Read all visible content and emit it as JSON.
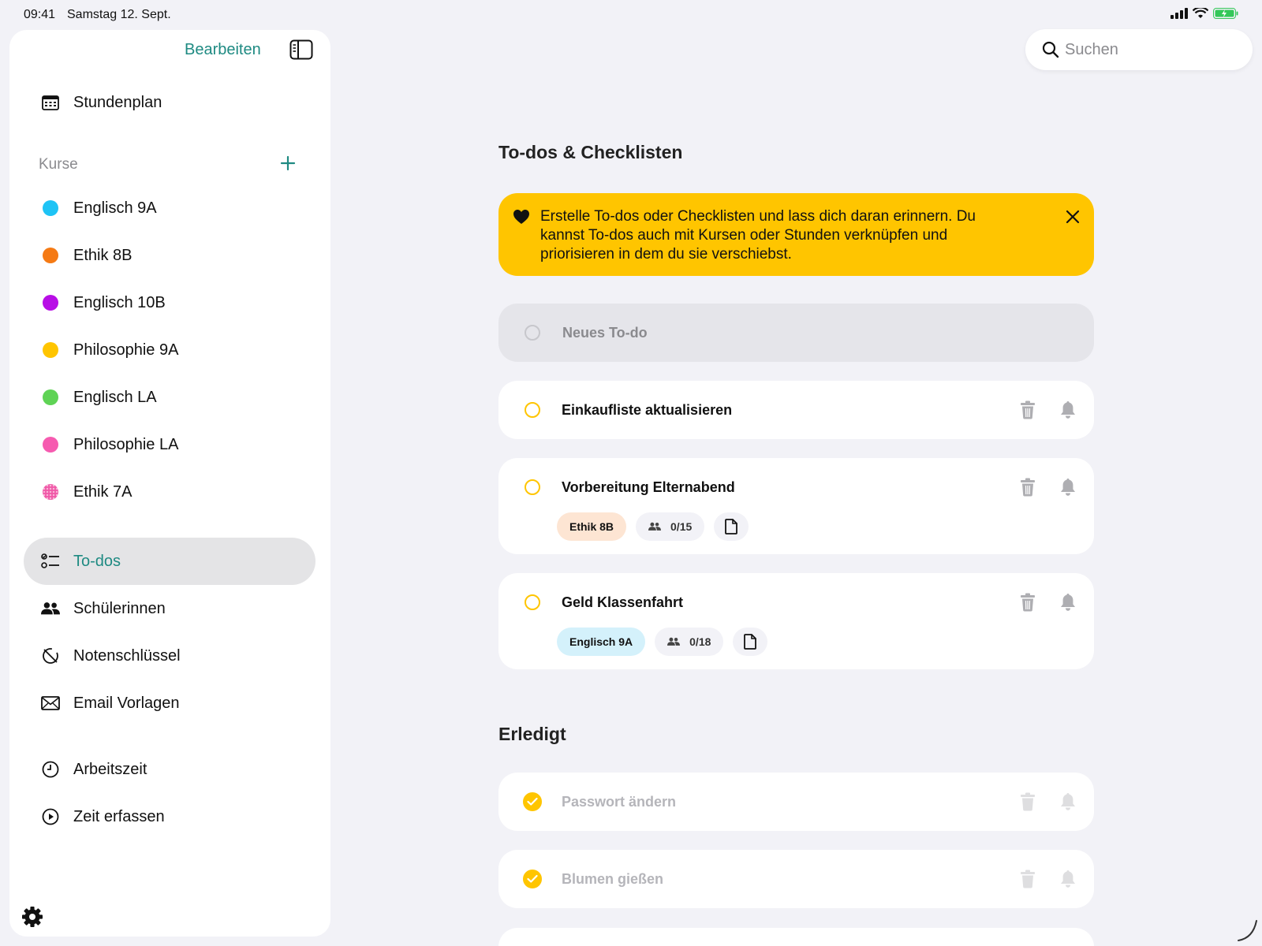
{
  "status_bar": {
    "time": "09:41",
    "date": "Samstag 12. Sept."
  },
  "sidebar": {
    "edit_label": "Bearbeiten",
    "schedule_label": "Stundenplan",
    "courses_section_label": "Kurse",
    "courses": [
      {
        "label": "Englisch 9A",
        "color": "#1ec3f5"
      },
      {
        "label": "Ethik 8B",
        "color": "#f57a14"
      },
      {
        "label": "Englisch 10B",
        "color": "#b80ee6"
      },
      {
        "label": "Philosophie 9A",
        "color": "#ffc500"
      },
      {
        "label": "Englisch LA",
        "color": "#5fd355"
      },
      {
        "label": "Philosophie LA",
        "color": "#f65bb0"
      },
      {
        "label": "Ethik 7A",
        "color": "#f05aa8"
      }
    ],
    "items": [
      {
        "label": "To-dos",
        "active": true
      },
      {
        "label": "Schülerinnen"
      },
      {
        "label": "Notenschlüssel"
      },
      {
        "label": "Email Vorlagen"
      },
      {
        "label": "Arbeitszeit"
      },
      {
        "label": "Zeit erfassen"
      }
    ]
  },
  "search": {
    "placeholder": "Suchen"
  },
  "main": {
    "title": "To-dos & Checklisten",
    "banner_text": "Erstelle To-dos oder Checklisten und lass dich daran erinnern. Du kannst To-dos auch mit Kursen oder Stunden verknüpfen und priorisieren in dem du sie verschiebst.",
    "new_todo_placeholder": "Neues To-do",
    "todos": [
      {
        "title": "Einkaufliste aktualisieren"
      },
      {
        "title": "Vorbereitung Elternabend",
        "course": "Ethik 8B",
        "students": "0/15"
      },
      {
        "title": "Geld Klassenfahrt",
        "course": "Englisch 9A",
        "students": "0/18"
      }
    ],
    "done_title": "Erledigt",
    "done": [
      {
        "title": "Passwort ändern"
      },
      {
        "title": "Blumen gießen"
      }
    ]
  },
  "colors": {
    "accent": "#1e8a82",
    "highlight": "#ffc500"
  }
}
